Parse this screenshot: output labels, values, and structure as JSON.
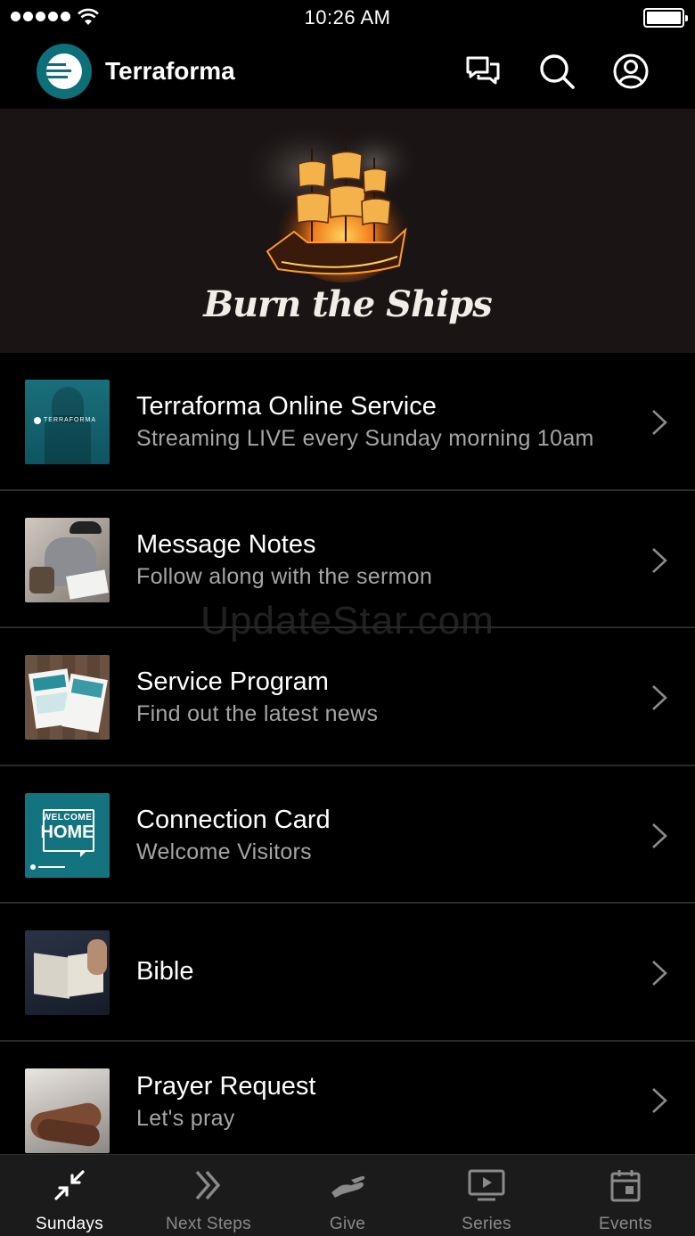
{
  "status_bar": {
    "time": "10:26 AM"
  },
  "header": {
    "title": "Terraforma"
  },
  "hero": {
    "title": "Burn the Ships"
  },
  "watermark": "UpdateStar.com",
  "list": [
    {
      "title": "Terraforma Online Service",
      "subtitle": "Streaming LIVE every Sunday morning 10am",
      "thumb_text": "TERRAFORMA"
    },
    {
      "title": "Message Notes",
      "subtitle": "Follow along with the sermon"
    },
    {
      "title": "Service Program",
      "subtitle": "Find out the latest news"
    },
    {
      "title": "Connection Card",
      "subtitle": "Welcome Visitors",
      "thumb_text": "WELCOME",
      "thumb_text2": "HOME"
    },
    {
      "title": "Bible"
    },
    {
      "title": "Prayer Request",
      "subtitle": "Let's pray"
    }
  ],
  "tabs": [
    {
      "label": "Sundays",
      "icon": "collapse-arrows-icon",
      "active": true
    },
    {
      "label": "Next Steps",
      "icon": "double-chevron-icon"
    },
    {
      "label": "Give",
      "icon": "give-hand-icon"
    },
    {
      "label": "Series",
      "icon": "play-screen-icon"
    },
    {
      "label": "Events",
      "icon": "calendar-icon"
    }
  ],
  "colors": {
    "accent": "#0d6f78",
    "background": "#000000",
    "tabbar": "#1b1b1b",
    "subtitle": "#a5a5a5"
  }
}
